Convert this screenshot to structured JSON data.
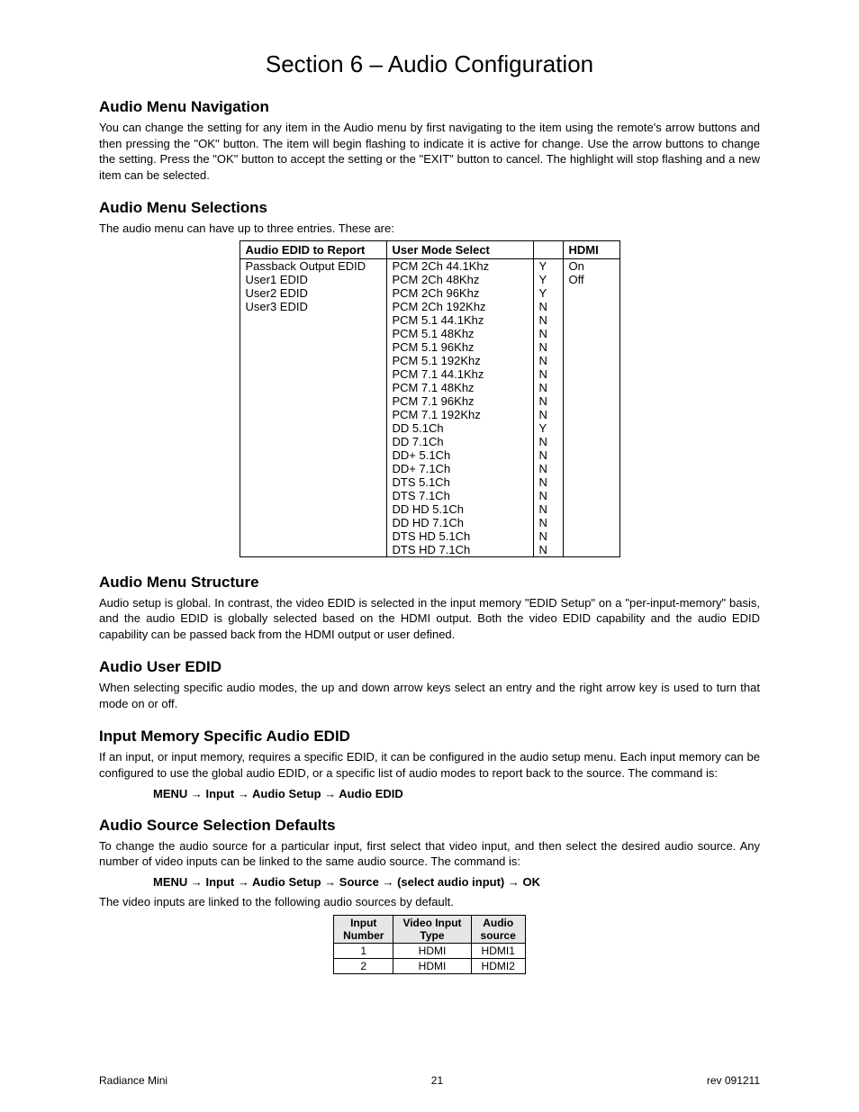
{
  "title": "Section 6 – Audio Configuration",
  "s1": {
    "heading": "Audio Menu Navigation",
    "p1": "You can change the setting for any item in the Audio menu by first navigating to the item using the remote's arrow buttons and then pressing the \"OK\" button. The item will begin flashing to indicate it is active for change. Use the arrow buttons to change the setting. Press the \"OK\" button to accept the setting or the \"EXIT\" button to cancel. The highlight will stop flashing and a new item can be selected."
  },
  "s2": {
    "heading": "Audio Menu Selections",
    "p1": "The audio menu can have up to three entries. These are:"
  },
  "table1": {
    "headers": {
      "c0": "Audio EDID to Report",
      "c1": "User Mode Select",
      "c2": "",
      "c3": "HDMI"
    },
    "edid": [
      "Passback Output EDID",
      "User1 EDID",
      "User2 EDID",
      "User3 EDID"
    ],
    "modes": [
      {
        "m": "PCM 2Ch 44.1Khz",
        "yn": "Y"
      },
      {
        "m": "PCM 2Ch 48Khz",
        "yn": "Y"
      },
      {
        "m": "PCM 2Ch 96Khz",
        "yn": "Y"
      },
      {
        "m": "PCM 2Ch 192Khz",
        "yn": "N"
      },
      {
        "m": "PCM 5.1 44.1Khz",
        "yn": "N"
      },
      {
        "m": "PCM 5.1 48Khz",
        "yn": "N"
      },
      {
        "m": "PCM 5.1 96Khz",
        "yn": "N"
      },
      {
        "m": "PCM 5.1 192Khz",
        "yn": "N"
      },
      {
        "m": "PCM 7.1 44.1Khz",
        "yn": "N"
      },
      {
        "m": "PCM 7.1 48Khz",
        "yn": "N"
      },
      {
        "m": "PCM 7.1 96Khz",
        "yn": "N"
      },
      {
        "m": "PCM 7.1 192Khz",
        "yn": "N"
      },
      {
        "m": "DD 5.1Ch",
        "yn": "Y"
      },
      {
        "m": "DD 7.1Ch",
        "yn": "N"
      },
      {
        "m": "DD+ 5.1Ch",
        "yn": "N"
      },
      {
        "m": "DD+ 7.1Ch",
        "yn": "N"
      },
      {
        "m": "DTS 5.1Ch",
        "yn": "N"
      },
      {
        "m": "DTS 7.1Ch",
        "yn": "N"
      },
      {
        "m": "DD HD 5.1Ch",
        "yn": "N"
      },
      {
        "m": "DD HD 7.1Ch",
        "yn": "N"
      },
      {
        "m": "DTS HD 5.1Ch",
        "yn": "N"
      },
      {
        "m": "DTS HD 7.1Ch",
        "yn": "N"
      }
    ],
    "hdmi": [
      "On",
      "Off"
    ]
  },
  "s3": {
    "heading": "Audio Menu Structure",
    "p1": "Audio setup is global. In contrast, the video EDID is selected in the input memory \"EDID Setup\" on a \"per-input-memory\" basis, and the audio EDID is globally selected based on the HDMI output. Both the video EDID capability and the audio EDID capability can be passed back from the HDMI output or user defined."
  },
  "s4": {
    "heading": "Audio User EDID",
    "p1": "When selecting specific audio modes, the up and down arrow keys select an entry and the right arrow key is used to turn that mode on or off."
  },
  "s5": {
    "heading": "Input Memory Specific Audio EDID",
    "p1": "If an input, or input memory, requires a specific EDID, it can be configured in the audio setup menu. Each input memory can be configured to use the global audio EDID, or a specific list of audio modes to report back to the source. The command is:",
    "path": "MENU → Input → Audio Setup → Audio EDID"
  },
  "s6": {
    "heading": "Audio Source Selection Defaults",
    "p1": "To change the audio source for a particular input, first select that video input, and then select the desired audio source. Any number of video inputs can be linked to the same audio source. The command is:",
    "path": "MENU → Input → Audio Setup → Source → (select audio input) → OK",
    "p2": "The video inputs are linked to the following audio sources by default."
  },
  "table2": {
    "headers": {
      "c0": "Input Number",
      "c1": "Video Input Type",
      "c2": "Audio source"
    },
    "rows": [
      {
        "n": "1",
        "v": "HDMI",
        "a": "HDMI1"
      },
      {
        "n": "2",
        "v": "HDMI",
        "a": "HDMI2"
      }
    ]
  },
  "footer": {
    "left": "Radiance Mini",
    "center": "21",
    "right": "rev 091211"
  }
}
